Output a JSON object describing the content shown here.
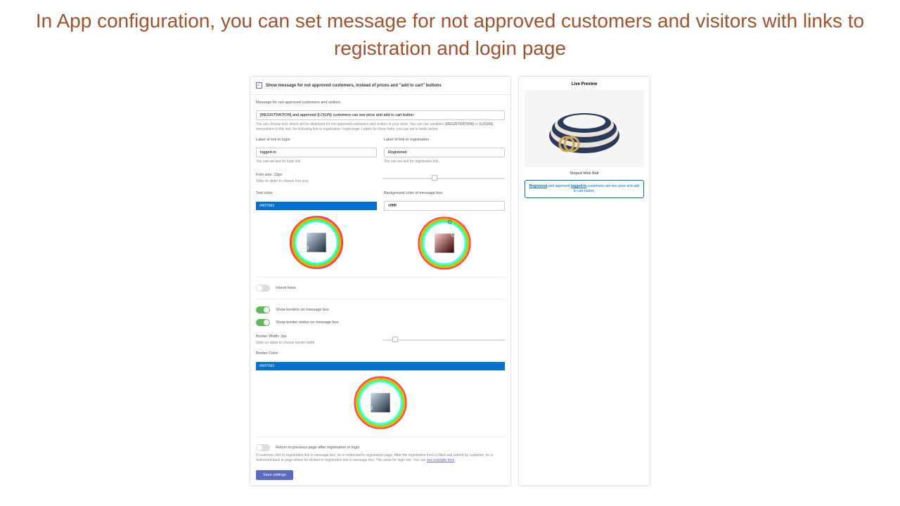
{
  "title": "In App configuration, you can set message for not approved customers and visitors with links to registration and login page",
  "header": {
    "checkbox_label": "Show message for not approved customers, instead of prices and \"add to cart\" buttons"
  },
  "message": {
    "label": "Message for not approved customers and visitors",
    "value": "{REGISTRATION} and approved {LOGIN} customers can see price and add to cart button",
    "helper_prefix": "You can choose text, which will be displayed for not approved customers and visitors in your store. You can use variables ",
    "helper_var1": "{REGISTRATION}",
    "helper_mid": " or ",
    "helper_var2": "{LOGIN}",
    "helper_suffix": " everywhere in this text, for including link to registration / login page. Labels for these links, you can set in fields below."
  },
  "login_link": {
    "label": "Label of link to login",
    "value": "logged-in",
    "helper": "You can set text for login link."
  },
  "reg_link": {
    "label": "Label of link to registration",
    "value": "Registered",
    "helper": "You can set text for registration link."
  },
  "font_size": {
    "label": "Font size: 13px",
    "helper": "Slide on slider to choose font size."
  },
  "text_color": {
    "label": "Text color",
    "value": "#0070d1"
  },
  "bg_color": {
    "label": "Background color of message box",
    "value": "#ffffff"
  },
  "inherit_fonts": {
    "label": "Inherit fonts"
  },
  "show_borders": {
    "label": "Show borders on message box"
  },
  "show_radius": {
    "label": "Show border radius on message box"
  },
  "border_width": {
    "label": "Border Width: 2px",
    "helper": "Slide on slider to choose border width"
  },
  "border_color": {
    "label": "Border Color:",
    "value": "#0070d1"
  },
  "return_prev": {
    "label": "Return to previous page after registration or login"
  },
  "return_helper": {
    "text": "If customer click to registration link in message box, he is redirected to registration page. After the registration form is filled and submit by customer, he is redirected back to page where he clicked to registration link in message box. The same for login link. You can ",
    "link": "see example here"
  },
  "save_btn": "Save settings",
  "preview": {
    "title": "Live Preview",
    "product_name": "Striped Web Belt",
    "msg_reg": "Registered",
    "msg_mid1": " and approved ",
    "msg_login": "logged-in",
    "msg_end": " customers can see price and add to cart button."
  }
}
